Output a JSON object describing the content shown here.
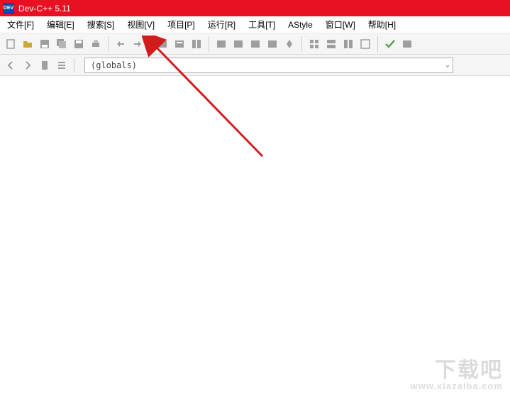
{
  "titlebar": {
    "app_icon_label": "DEV",
    "title": "Dev-C++ 5.11"
  },
  "menubar": {
    "items": [
      "文件[F]",
      "编辑[E]",
      "搜索[S]",
      "视图[V]",
      "项目[P]",
      "运行[R]",
      "工具[T]",
      "AStyle",
      "窗口[W]",
      "帮助[H]"
    ]
  },
  "toolbar": {
    "groups": [
      [
        "new-file",
        "open-file",
        "save",
        "save-all",
        "save-as",
        "print"
      ],
      [
        "undo",
        "redo"
      ],
      [
        "find",
        "replace",
        "find-in-files"
      ],
      [
        "compile",
        "run",
        "compile-run",
        "rebuild",
        "debug"
      ],
      [
        "toggle-breakpoint",
        "step-into",
        "step-over",
        "stop"
      ],
      [
        "check",
        "goto-line"
      ]
    ]
  },
  "secondbar": {
    "nav_buttons": [
      "back",
      "forward",
      "bookmark-add",
      "bookmark-list"
    ],
    "scope_selector": {
      "value": "(globals)"
    }
  },
  "watermark": {
    "line1": "下载吧",
    "line2": "www.xiazaiba.com"
  }
}
